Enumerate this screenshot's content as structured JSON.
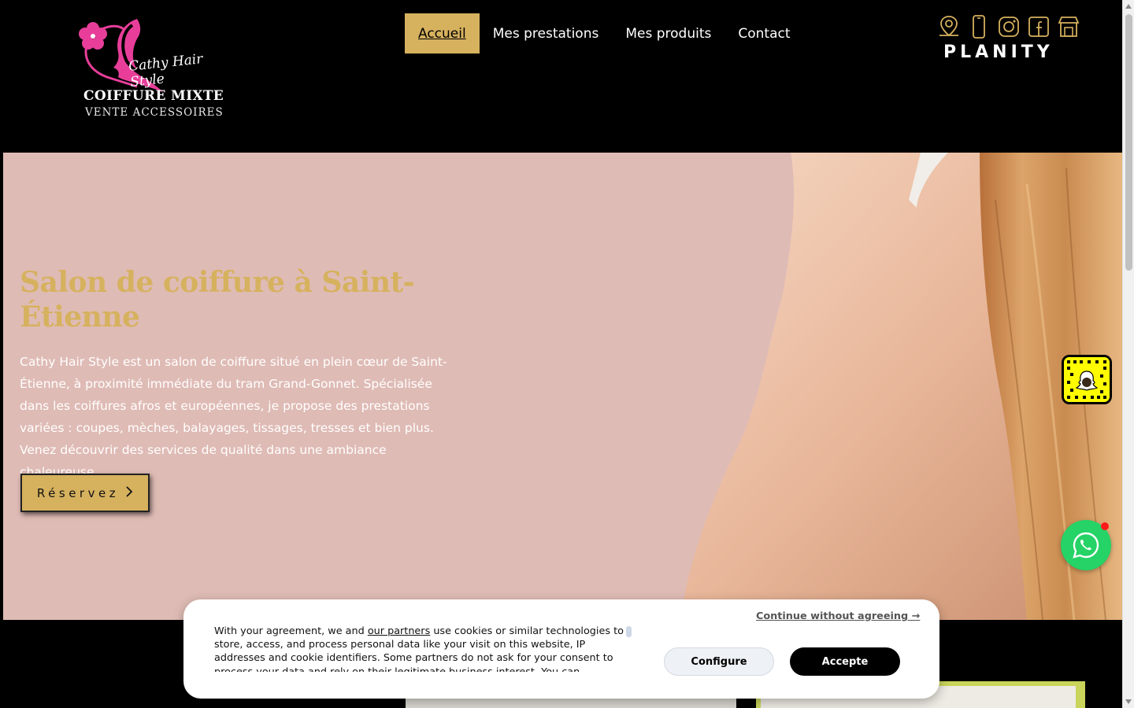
{
  "header": {
    "logo": {
      "script": "Cathy Hair Style",
      "main": "COIFFURE MIXTE",
      "sub": "VENTE ACCESSOIRES"
    },
    "nav": [
      {
        "label": "Accueil",
        "active": true
      },
      {
        "label": "Mes prestations",
        "active": false
      },
      {
        "label": "Mes produits",
        "active": false
      },
      {
        "label": "Contact",
        "active": false
      }
    ],
    "social_icons": [
      "map-pin-icon",
      "phone-icon",
      "instagram-icon",
      "facebook-icon",
      "shop-icon"
    ],
    "planity": "PLANITY"
  },
  "hero": {
    "title": "Salon de coiffure à Saint-Étienne",
    "text": "Cathy Hair Style est un salon de coiffure situé en plein cœur de Saint-Étienne, à proximité immédiate du tram Grand-Gonnet. Spécialisée dans les coiffures afros et européennes, je propose des prestations variées : coupes, mèches, balayages, tissages, tresses et bien plus. Venez découvrir des services de qualité dans une ambiance chaleureuse.",
    "button": "Réservez"
  },
  "cookie": {
    "text_before": "With your agreement, we and ",
    "partners_link": "our partners",
    "text_after": " use cookies or similar technologies to store, access, and process personal data like your visit on this website, IP addresses and cookie identifiers. Some partners do not ask for your consent to process your data and rely on their legitimate business interest. You can",
    "continue": "Continue without agreeing →",
    "configure": "Configure",
    "accept": "Accepte"
  },
  "colors": {
    "gold": "#d6b15e",
    "hero_bg": "#dfbbb5",
    "logo_pink": "#e83e9a",
    "whatsapp": "#25d366",
    "snapchat": "#fffc00"
  }
}
